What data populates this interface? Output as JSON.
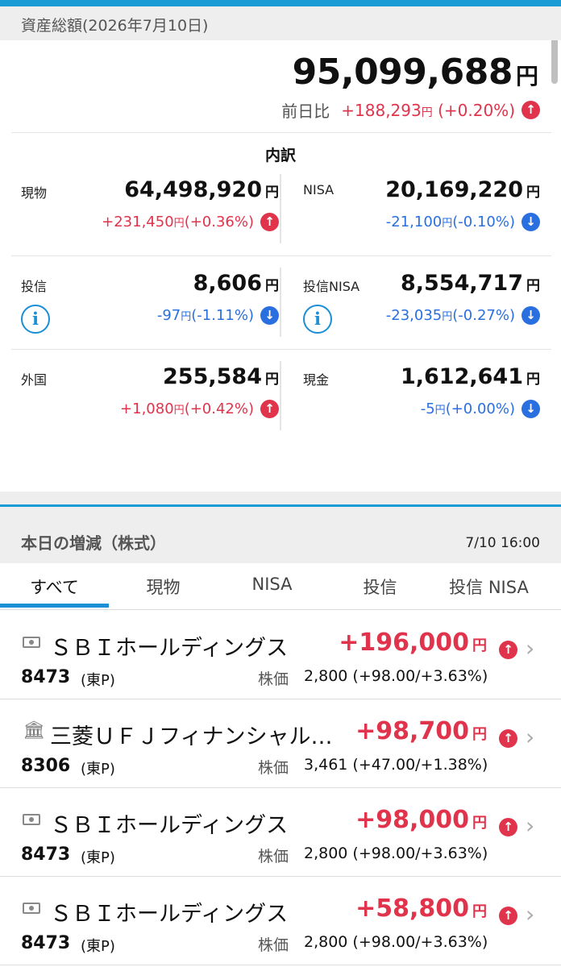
{
  "summary": {
    "header": "資産総額(2026年7月10日)",
    "total": "95,099,688",
    "yen": "円",
    "diff_label": "前日比",
    "diff_value": "+188,293",
    "diff_pct": "(+0.20%)"
  },
  "breakdown": {
    "title": "内訳",
    "items": [
      {
        "label": "現物",
        "amount": "64,498,920",
        "change": "+231,450",
        "pct": "(+0.36%)",
        "dir": "up"
      },
      {
        "label": "NISA",
        "amount": "20,169,220",
        "change": "-21,100",
        "pct": "(-0.10%)",
        "dir": "down"
      },
      {
        "label": "投信",
        "amount": "8,606",
        "change": "-97",
        "pct": "(-1.11%)",
        "dir": "down"
      },
      {
        "label": "投信NISA",
        "amount": "8,554,717",
        "change": "-23,035",
        "pct": "(-0.27%)",
        "dir": "down"
      },
      {
        "label": "外国",
        "amount": "255,584",
        "change": "+1,080",
        "pct": "(+0.42%)",
        "dir": "up"
      },
      {
        "label": "現金",
        "amount": "1,612,641",
        "change": "-5",
        "pct": "(+0.00%)",
        "dir": "down"
      }
    ]
  },
  "section": {
    "title": "本日の増減（株式）",
    "datetime": "7/10 16:00"
  },
  "tabs": [
    "すべて",
    "現物",
    "NISA",
    "投信",
    "投信 NISA"
  ],
  "stocks": [
    {
      "icon": "money-icon",
      "name": "ＳＢＩホールディングス",
      "profit": "+196,000",
      "code": "8473",
      "market": "(東P)",
      "price_label": "株価",
      "price": "2,800 (+98.00/+3.63%)"
    },
    {
      "icon": "bank-icon",
      "name": "三菱ＵＦＪフィナンシャル・グループ",
      "profit": "+98,700",
      "code": "8306",
      "market": "(東P)",
      "price_label": "株価",
      "price": "3,461 (+47.00/+1.38%)"
    },
    {
      "icon": "money-icon",
      "name": "ＳＢＩホールディングス",
      "profit": "+98,000",
      "code": "8473",
      "market": "(東P)",
      "price_label": "株価",
      "price": "2,800 (+98.00/+3.63%)"
    },
    {
      "icon": "money-icon",
      "name": "ＳＢＩホールディングス",
      "profit": "+58,800",
      "code": "8473",
      "market": "(東P)",
      "price_label": "株価",
      "price": "2,800 (+98.00/+3.63%)"
    }
  ],
  "colors": {
    "accent": "#1a9bd6",
    "up": "#e0334c",
    "down": "#2a6fe0"
  }
}
